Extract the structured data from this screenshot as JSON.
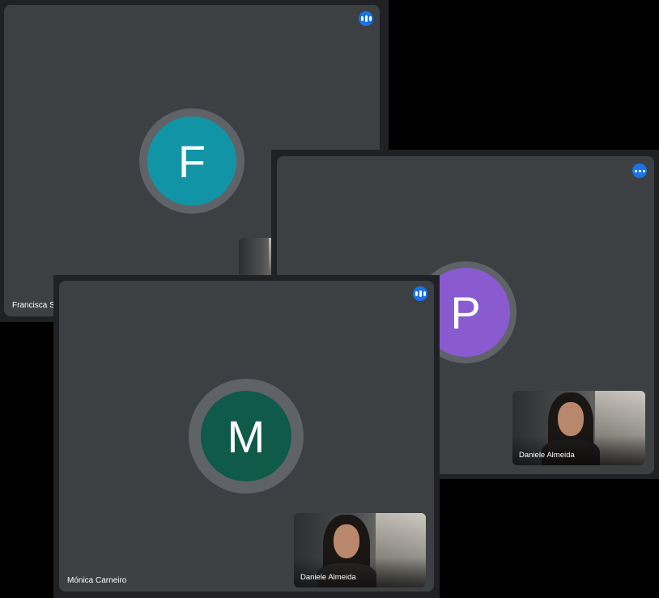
{
  "colors": {
    "window_bg": "#202124",
    "tile_bg": "#3c4043",
    "avatar_ring": "#5f6368",
    "more_button": "#1a73e8"
  },
  "windows": [
    {
      "participant_name": "Francisca S",
      "avatar_letter": "F",
      "avatar_color": "#1195a6",
      "menu_icon": "more-options-icon"
    },
    {
      "participant_name": "",
      "avatar_letter": "P",
      "avatar_color": "#8a5ad0",
      "menu_icon": "more-options-icon",
      "self_view_name": "Daniele Almeida"
    },
    {
      "participant_name": "Mónica Carneiro",
      "avatar_letter": "M",
      "avatar_color": "#0f5a4a",
      "menu_icon": "more-options-icon",
      "self_view_name": "Daniele Almeida"
    }
  ]
}
